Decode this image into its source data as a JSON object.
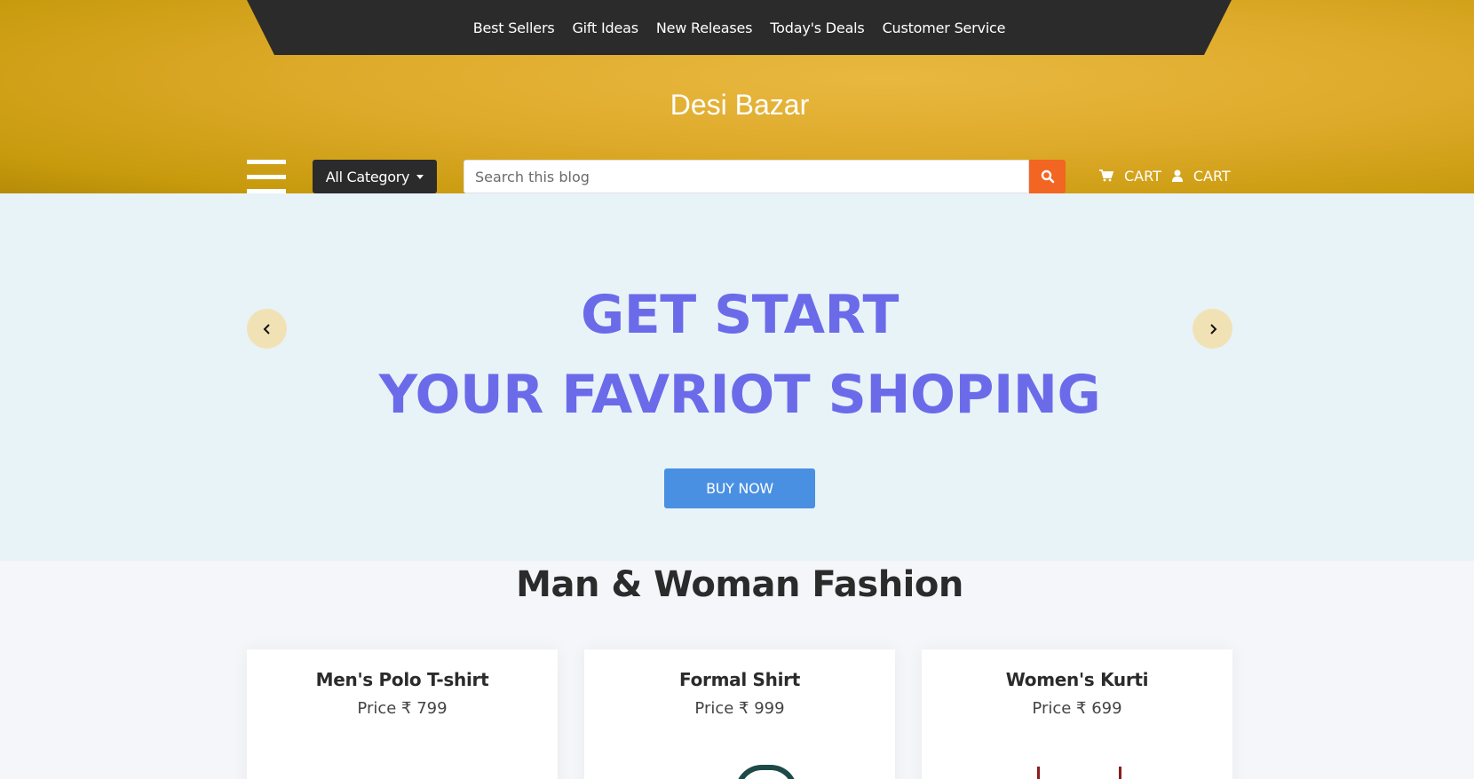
{
  "header": {
    "nav": [
      "Best Sellers",
      "Gift Ideas",
      "New Releases",
      "Today's Deals",
      "Customer Service"
    ],
    "brand": "Desi Bazar",
    "category_label": "All Category",
    "search_placeholder": "Search this blog",
    "cart_label": "CART",
    "account_label": "CART"
  },
  "hero": {
    "line1": "GET START",
    "line2": "YOUR FAVRIOT SHOPING",
    "button": "BUY NOW"
  },
  "section": {
    "title": "Man & Woman Fashion",
    "products": [
      {
        "name": "Men's Polo T-shirt",
        "price": "Price ₹ 799"
      },
      {
        "name": "Formal Shirt",
        "price": "Price ₹ 999"
      },
      {
        "name": "Women's Kurti",
        "price": "Price ₹ 699"
      }
    ]
  },
  "colors": {
    "nav_bar": "#2b2b2b",
    "header_gold": "#deaa2a",
    "search_button": "#f26522",
    "hero_bg": "#e8f3f8",
    "hero_text": "#6b6bea",
    "buy_button": "#4a90e2",
    "arrow_bg": "#f1e2b6"
  },
  "icons": {
    "menu": "hamburger-menu-icon",
    "search": "search-icon",
    "cart": "cart-icon",
    "user": "user-icon",
    "prev": "chevron-left-icon",
    "next": "chevron-right-icon"
  }
}
